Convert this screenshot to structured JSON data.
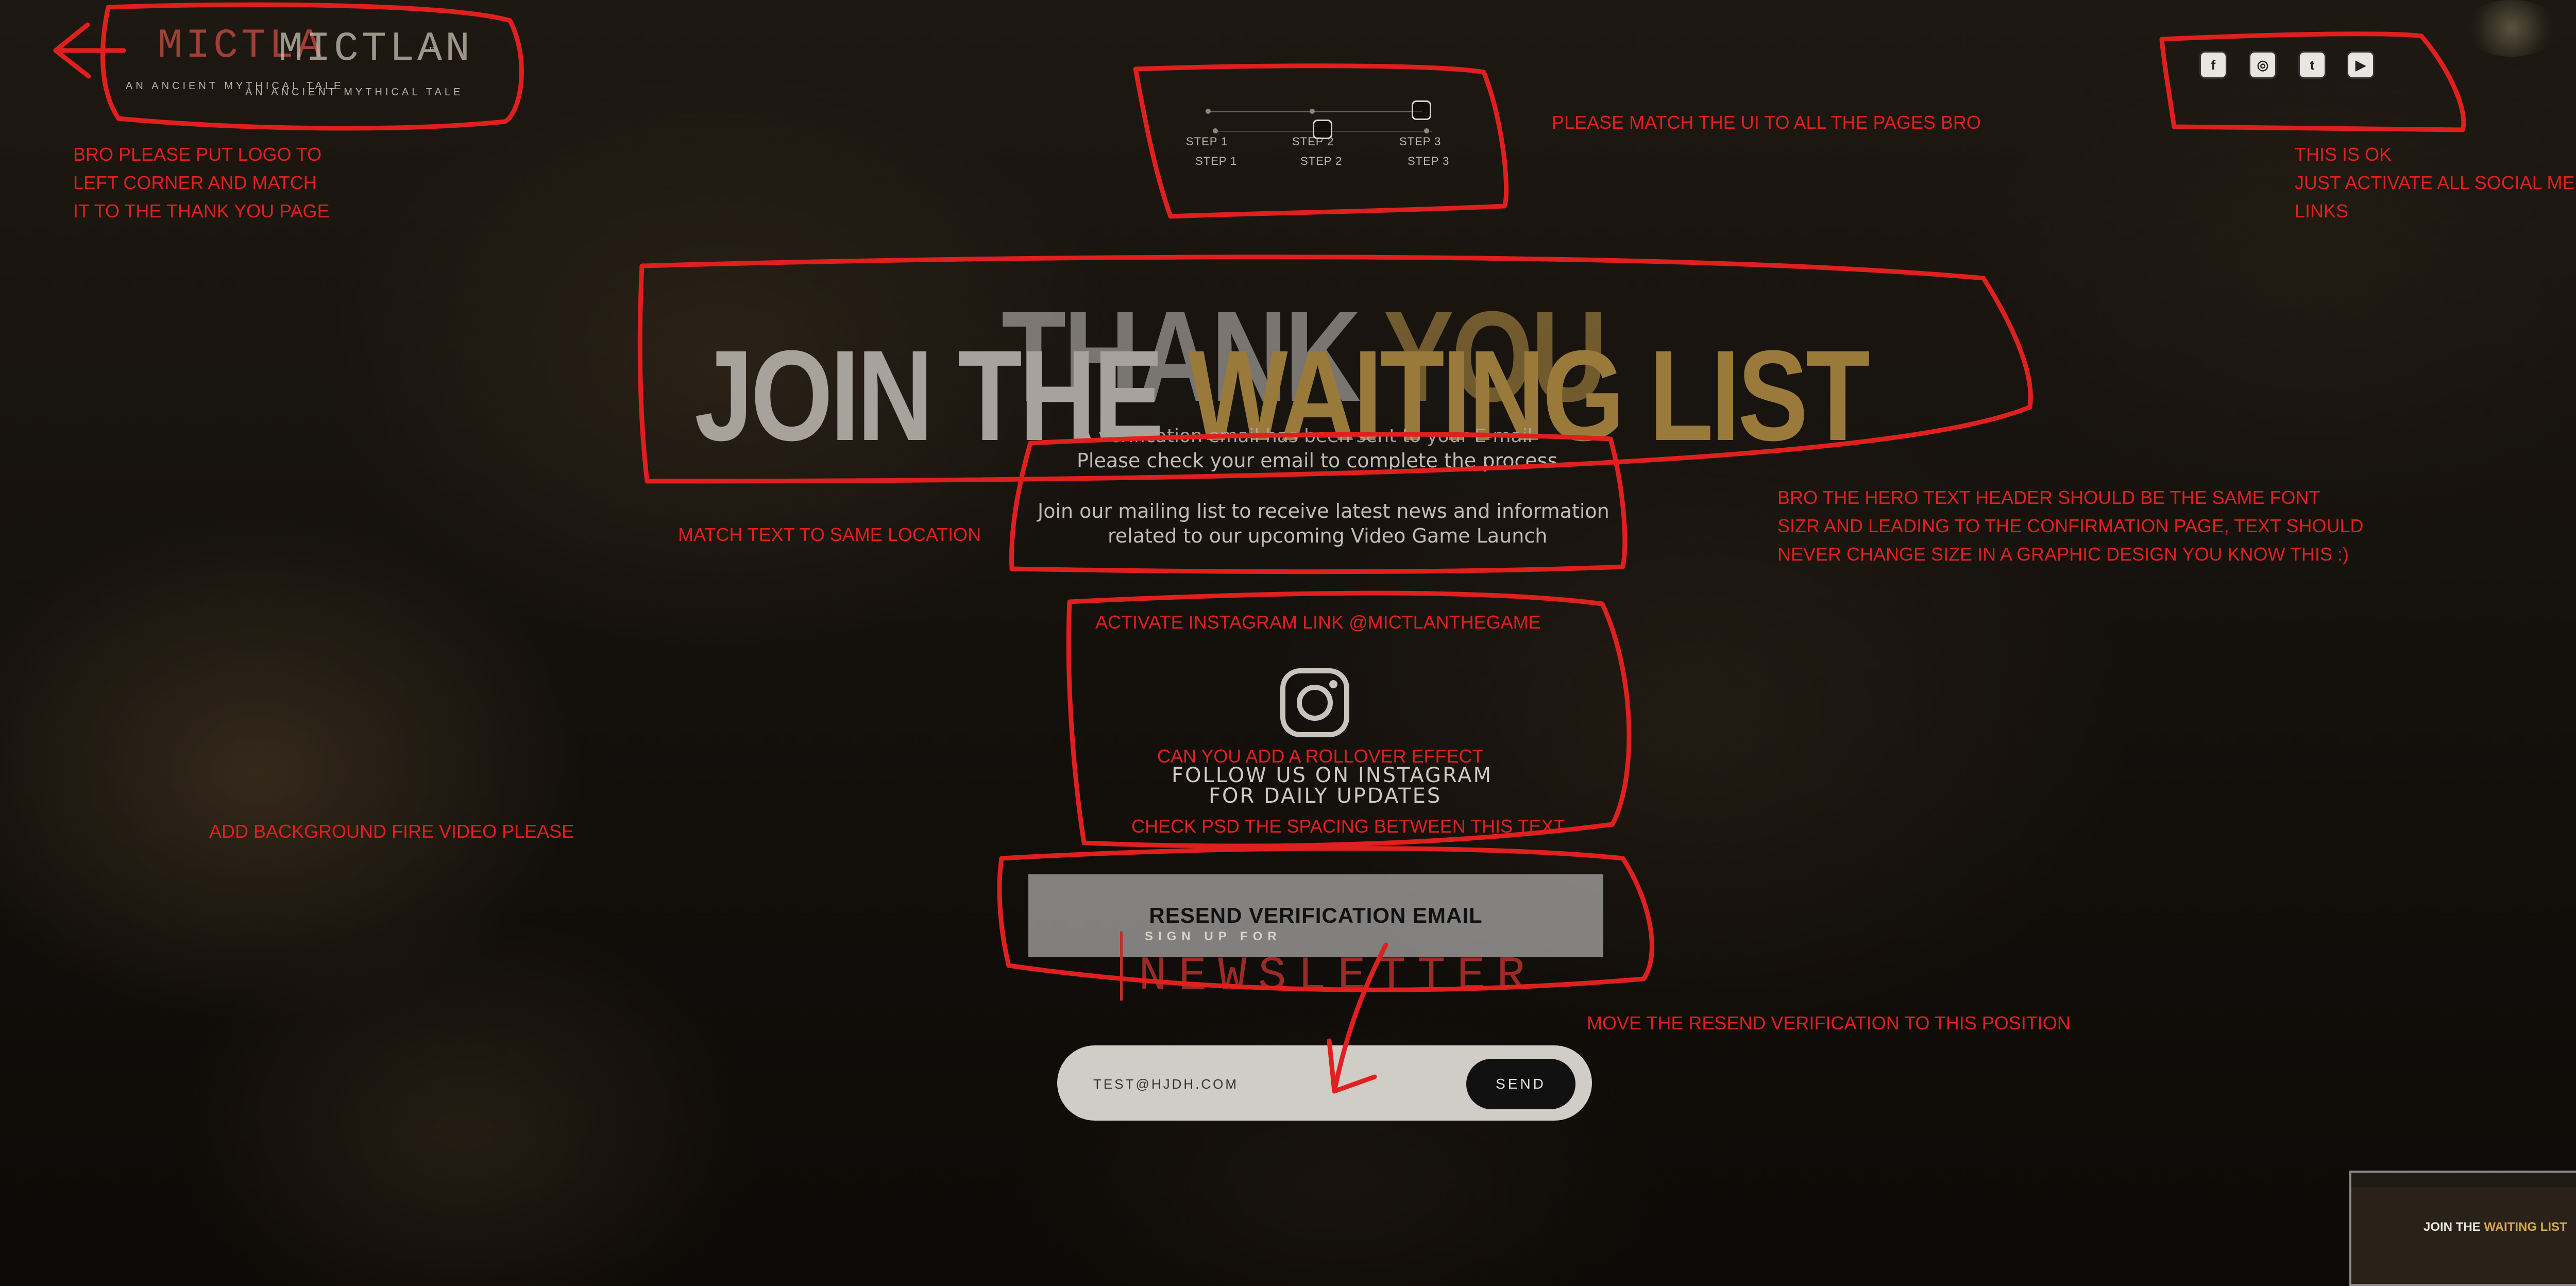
{
  "logo": {
    "word_1": "MICTLA",
    "word_2": "MICTLAN",
    "tm": "™",
    "tagline_1": "AN ANCIENT MYTHICAL TALE",
    "tagline_2": "AN ANCIENT MYTHICAL TALE"
  },
  "steps": {
    "top_row": [
      "STEP 1",
      "STEP 2",
      "STEP 3"
    ],
    "bottom_row": [
      "STEP 1",
      "STEP 2",
      "STEP 3"
    ]
  },
  "social": {
    "icons": [
      "facebook-icon",
      "instagram-icon",
      "twitter-icon",
      "youtube-icon"
    ],
    "glyphs": [
      "f",
      "◎",
      "t",
      "▶"
    ]
  },
  "hero": {
    "thank_white": "THANK ",
    "thank_gold": "YOU",
    "join_white": "JOIN THE ",
    "join_gold": "WAITING LIST"
  },
  "text": {
    "verification": "A verification email has been sent to your E-mail",
    "check": "Please check your email to complete the process",
    "mailing_1": "Join our mailing list to receive latest news and information",
    "mailing_2": "related to our upcoming Video Game Launch"
  },
  "instagram": {
    "follow_1": "FOLLOW US ON INSTAGRAM",
    "follow_2": "FOR DAILY UPDATES"
  },
  "resend": {
    "label": "RESEND VERIFICATION EMAIL"
  },
  "newsletter": {
    "small": "SIGN UP FOR",
    "big": "NEWSLETTER",
    "email_value": "TEST@HJDH.COM",
    "send_label": "SEND"
  },
  "notes": {
    "logo": "BRO PLEASE PUT LOGO TO\nLEFT CORNER AND MATCH\nIT TO THE THANK YOU PAGE",
    "match_ui": "PLEASE MATCH THE UI TO ALL THE PAGES BRO",
    "social_ok": "THIS IS OK\nJUST ACTIVATE ALL SOCIAL MEDIA\nLINKS",
    "hero_font": "BRO THE HERO TEXT HEADER SHOULD BE THE SAME FONT\nSIZR AND LEADING TO THE CONFIRMATION PAGE, TEXT SHOULD\nNEVER CHANGE SIZE IN A GRAPHIC DESIGN YOU KNOW THIS :)",
    "match_text": "MATCH TEXT TO SAME LOCATION",
    "activate_ig": "ACTIVATE INSTAGRAM LINK @MICTLANTHEGAME",
    "rollover": "CAN YOU ADD A ROLLOVER EFFECT",
    "spacing": "CHECK PSD THE SPACING BETWEEN THIS TEXT",
    "fire_video": "ADD BACKGROUND FIRE VIDEO PLEASE",
    "move_resend": "MOVE THE RESEND VERIFICATION TO THIS POSITION"
  },
  "thumbnail": {
    "title_white": "JOIN THE ",
    "title_gold": "WAITING LIST"
  },
  "colors": {
    "annotation_red": "#e0201e",
    "gold": "#c9a24e",
    "logo_red": "#b8473c"
  }
}
